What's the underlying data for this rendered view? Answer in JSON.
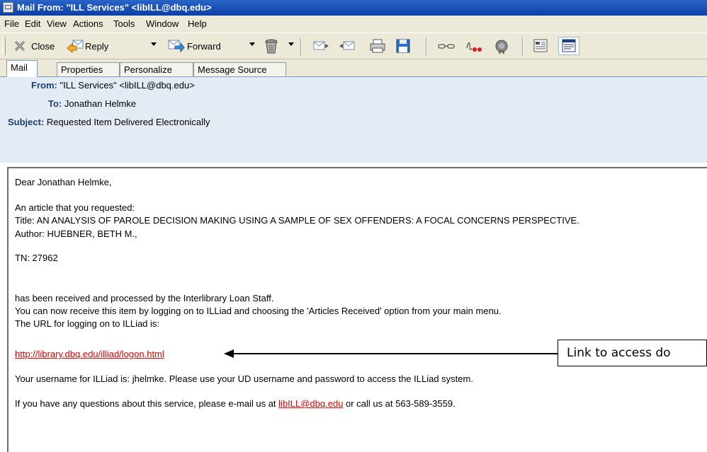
{
  "window": {
    "title": "Mail From: \"ILL Services\" <libILL@dbq.edu>"
  },
  "menu": [
    "File",
    "Edit",
    "View",
    "Actions",
    "Tools",
    "Window",
    "Help"
  ],
  "toolbar": {
    "close": "Close",
    "reply": "Reply",
    "forward": "Forward"
  },
  "tabs": [
    "Mail",
    "Properties",
    "Personalize",
    "Message Source"
  ],
  "header": {
    "from_label": "From:",
    "from_value": "\"ILL Services\" <libILL@dbq.edu>",
    "to_label": "To:",
    "to_value": "Jonathan Helmke",
    "subject_label": "Subject:",
    "subject_value": "Requested Item Delivered Electronically"
  },
  "message": {
    "greeting": "Dear Jonathan Helmke,",
    "intro": "An article that you requested:",
    "title_line": "Title: AN ANALYSIS OF PAROLE DECISION MAKING USING A SAMPLE OF SEX OFFENDERS: A FOCAL CONCERNS PERSPECTIVE.",
    "author_line": "Author: HUEBNER, BETH M.,",
    "tn_line": "TN: 27962",
    "received_line": "has been received and processed by the Interlibrary Loan Staff.",
    "receive_line": "You can now receive this item by logging on to ILLiad and choosing the 'Articles Received' option from your main menu.",
    "url_intro": "The URL for logging on to ILLiad is:",
    "url": "http://library.dbq.edu/illiad/logon.html",
    "username_line": "Your username for ILLiad is: jhelmke. Please use your UD username and password to access the ILLiad system.",
    "questions_prefix": "If you have any questions about this service, please e-mail us at ",
    "email": "libILL@dbq.edu",
    "questions_suffix": " or call us at 563-589-3559."
  },
  "callout": {
    "text": "Link to access do"
  }
}
